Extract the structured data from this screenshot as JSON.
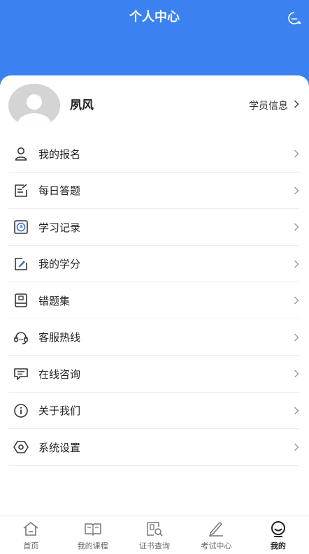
{
  "header": {
    "title": "个人中心",
    "message_icon": "message-icon",
    "bg_color": "#3b82f0"
  },
  "profile": {
    "username": "夙风",
    "info_link": "学员信息"
  },
  "menu": {
    "items": [
      {
        "label": "我的报名",
        "icon": "user-icon"
      },
      {
        "label": "每日答题",
        "icon": "edit-note-icon"
      },
      {
        "label": "学习记录",
        "icon": "clock-icon"
      },
      {
        "label": "我的学分",
        "icon": "pen-icon"
      },
      {
        "label": "错题集",
        "icon": "book-icon"
      },
      {
        "label": "客服热线",
        "icon": "headset-icon"
      },
      {
        "label": "在线咨询",
        "icon": "chat-icon"
      },
      {
        "label": "关于我们",
        "icon": "info-icon"
      },
      {
        "label": "系统设置",
        "icon": "settings-icon"
      }
    ]
  },
  "tabbar": {
    "tabs": [
      {
        "label": "首页",
        "icon": "home-icon"
      },
      {
        "label": "我的课程",
        "icon": "open-book-icon"
      },
      {
        "label": "证书查询",
        "icon": "certificate-search-icon"
      },
      {
        "label": "考试中心",
        "icon": "pencil-icon"
      },
      {
        "label": "我的",
        "icon": "profile-icon",
        "active": true
      }
    ]
  }
}
